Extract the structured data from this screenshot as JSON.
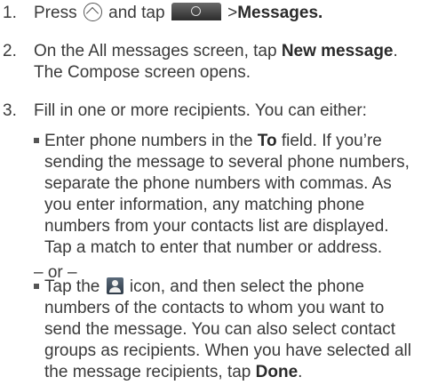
{
  "steps": [
    {
      "number": "1.",
      "parts": [
        "Press ",
        " and tap ",
        " >",
        "Messages."
      ]
    },
    {
      "number": "2.",
      "lines": [
        [
          "On the All messages screen, tap ",
          "New message",
          "."
        ],
        [
          "The Compose screen opens."
        ]
      ]
    },
    {
      "number": "3.",
      "intro": "Fill in one or more recipients. You can either:",
      "option1": {
        "lines": [
          [
            "Enter phone numbers in the ",
            "To",
            " field. If you’re"
          ],
          "sending the message to several phone numbers,",
          "separate the phone numbers with commas. As",
          "you enter information, any matching phone",
          "numbers from your contacts list are displayed.",
          "Tap a match to enter that number or address."
        ]
      },
      "or_text": "– or –",
      "option2": {
        "lines": [
          [
            "Tap the ",
            " icon, and then select the phone"
          ],
          "numbers of the contacts to whom you want to",
          "send the message. You can also select contact",
          "groups as recipients. When you have selected all",
          [
            "the message recipients, tap ",
            "Done",
            "."
          ]
        ]
      }
    }
  ],
  "icons": {
    "home": "home-icon",
    "app_tab": "all-apps-tab-icon",
    "contacts": "contacts-icon"
  }
}
